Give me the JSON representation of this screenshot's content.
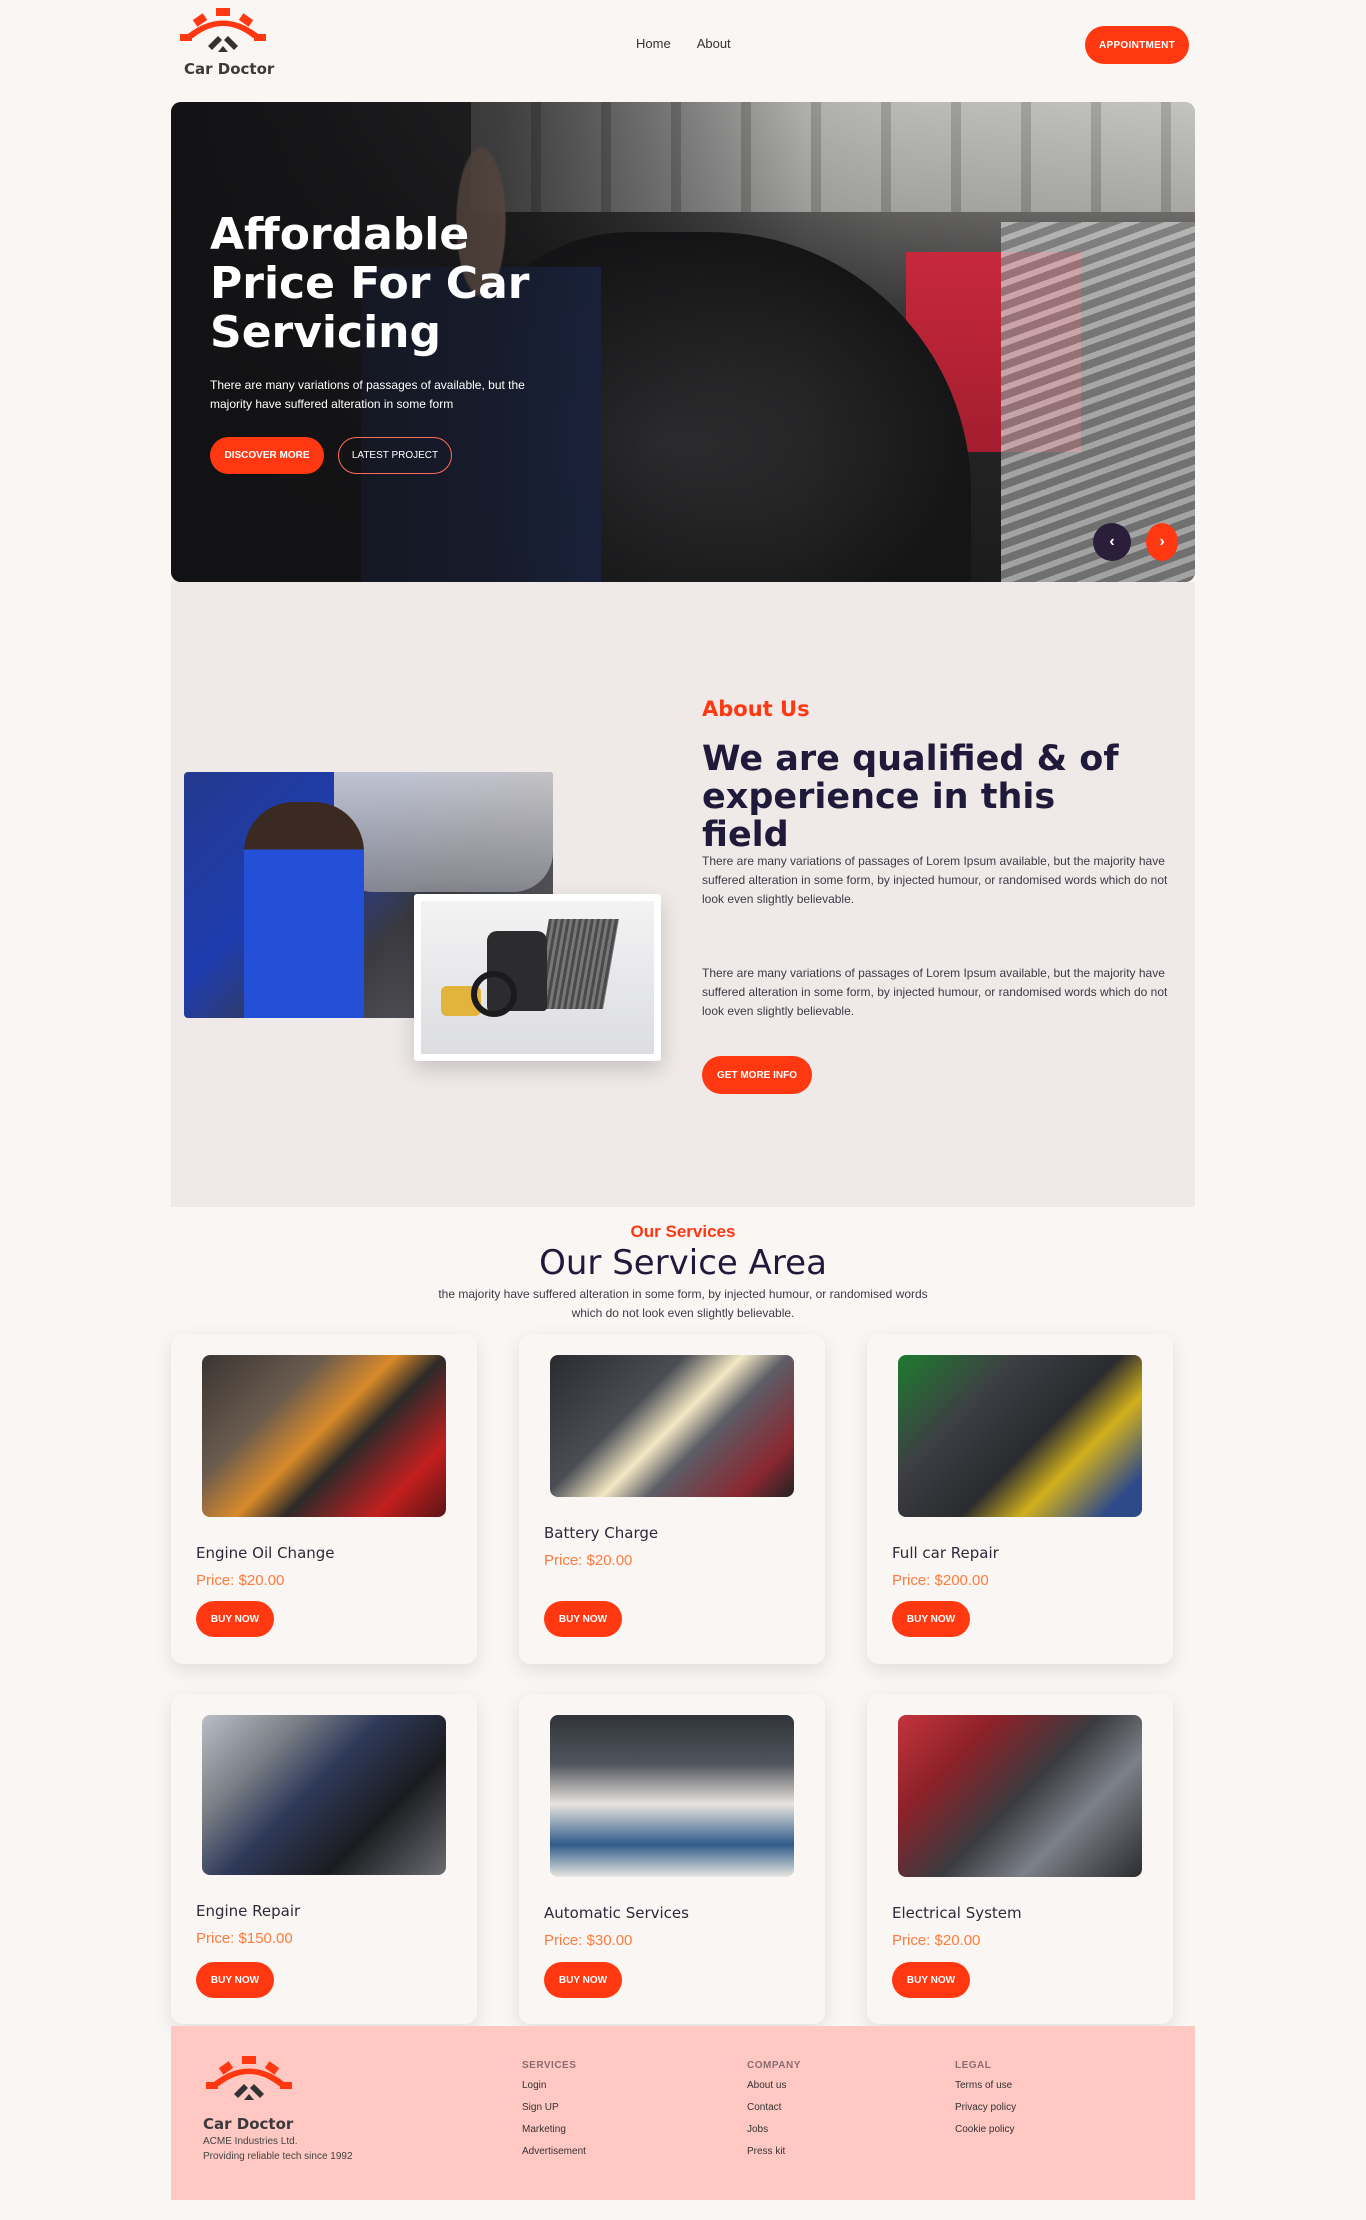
{
  "header": {
    "brand": "Car Doctor",
    "nav": [
      "Home",
      "About"
    ],
    "appointment_label": "APPOINTMENT"
  },
  "hero": {
    "title": "Affordable Price For Car Servicing",
    "subtitle": "There are many variations of passages of available, but the majority have suffered alteration in some form",
    "discover_label": "DISCOVER MORE",
    "latest_label": "LATEST PROJECT",
    "prev_icon": "‹",
    "next_icon": "›"
  },
  "about": {
    "label": "About Us",
    "title": "We are qualified & of experience in this field",
    "paragraph1": "There are many variations of passages of Lorem Ipsum available, but the majority have suffered alteration in some form, by injected humour, or randomised words which do not look even slightly believable.",
    "paragraph2": "There are many variations of passages of Lorem Ipsum available, but the majority have suffered alteration in some form, by injected humour, or randomised words which do not look even slightly believable.",
    "button_label": "GET MORE INFO"
  },
  "services": {
    "label": "Our Services",
    "title": "Our Service Area",
    "subtitle": "the majority have suffered alteration in some form, by injected humour, or randomised words which do not look even slightly believable.",
    "items": [
      {
        "name": "Engine Oil Change",
        "price": "Price: $20.00",
        "button": "BUY NOW"
      },
      {
        "name": "Battery Charge",
        "price": "Price: $20.00",
        "button": "BUY NOW"
      },
      {
        "name": "Full car Repair",
        "price": "Price: $200.00",
        "button": "BUY NOW"
      },
      {
        "name": "Engine Repair",
        "price": "Price: $150.00",
        "button": "BUY NOW"
      },
      {
        "name": "Automatic Services",
        "price": "Price: $30.00",
        "button": "BUY NOW"
      },
      {
        "name": "Electrical System",
        "price": "Price: $20.00",
        "button": "BUY NOW"
      }
    ]
  },
  "footer": {
    "brand": "Car Doctor",
    "company": "ACME Industries Ltd.",
    "tagline": "Providing reliable tech since 1992",
    "columns": [
      {
        "heading": "SERVICES",
        "links": [
          "Login",
          "Sign UP",
          "Marketing",
          "Advertisement"
        ]
      },
      {
        "heading": "COMPANY",
        "links": [
          "About us",
          "Contact",
          "Jobs",
          "Press kit"
        ]
      },
      {
        "heading": "LEGAL",
        "links": [
          "Terms of use",
          "Privacy policy",
          "Cookie policy"
        ]
      }
    ]
  },
  "colors": {
    "accent": "#ff3811",
    "dark": "#1f1a3a",
    "footer_bg": "#ffc8c3"
  },
  "icons": [
    "logo-gear-icon",
    "chevron-left-icon",
    "chevron-right-icon"
  ]
}
